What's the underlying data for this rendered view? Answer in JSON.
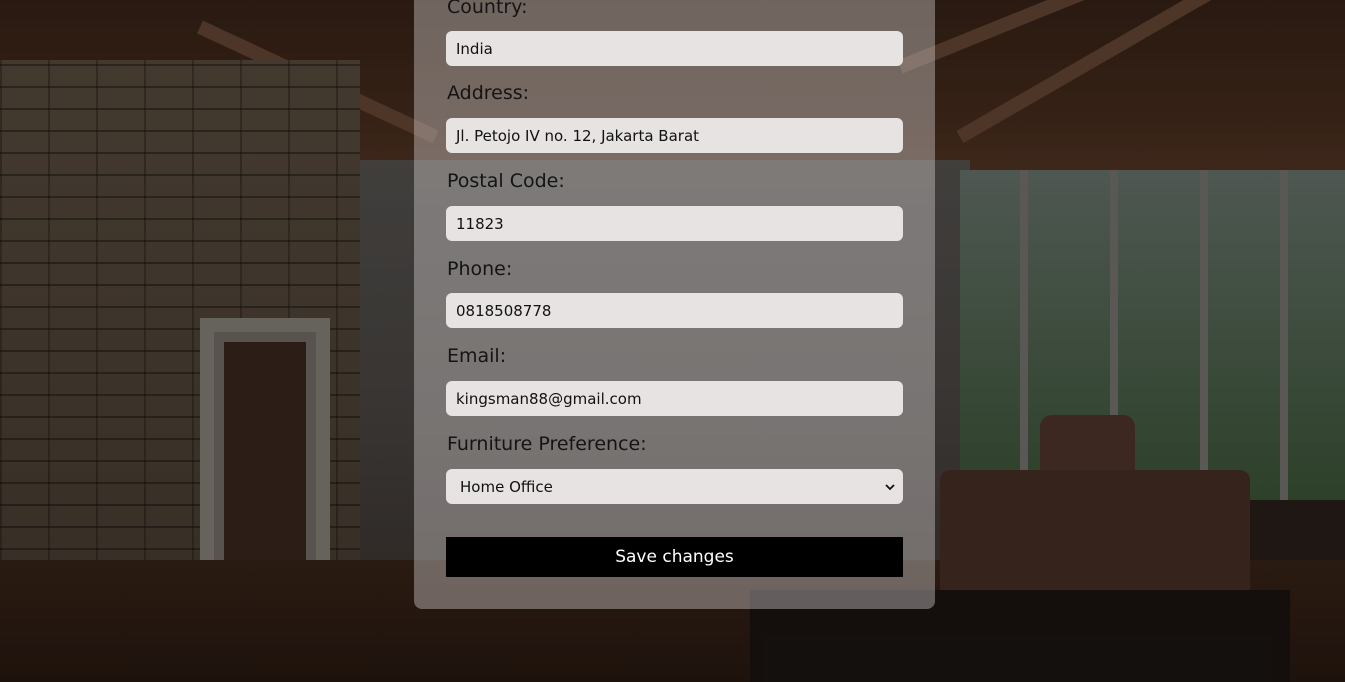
{
  "form": {
    "country_label": "Country:",
    "country_value": "India",
    "address_label": "Address:",
    "address_value": "Jl. Petojo IV no. 12, Jakarta Barat",
    "postal_label": "Postal Code:",
    "postal_value": "11823",
    "phone_label": "Phone:",
    "phone_value": "0818508778",
    "email_label": "Email:",
    "email_value": "kingsman88@gmail.com",
    "furniture_label": "Furniture Preference:",
    "furniture_value": "Home Office",
    "save_label": "Save changes"
  },
  "icons": {
    "select_indicator": "chevron-down-icon"
  },
  "colors": {
    "button_bg": "#000000",
    "button_text": "#ffffff",
    "input_bg": "#e6e3e2"
  }
}
